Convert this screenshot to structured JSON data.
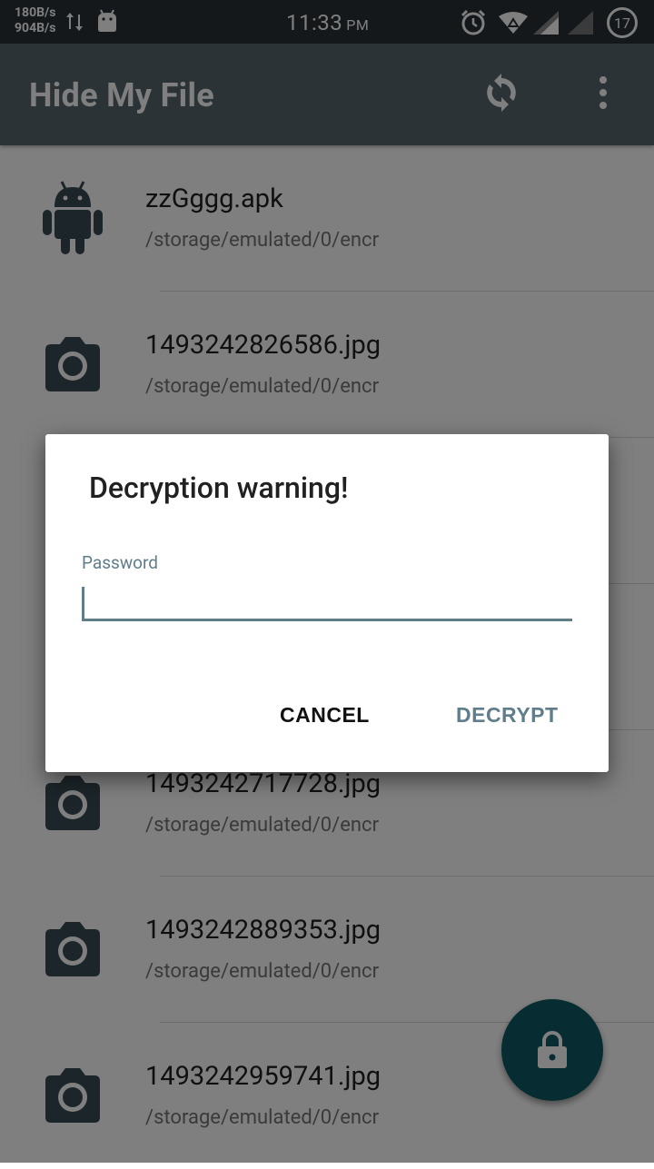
{
  "status_bar": {
    "speed_up": "180B/s",
    "speed_down": "904B/s",
    "time": "11:33",
    "ampm": "PM",
    "battery": "17"
  },
  "app_bar": {
    "title": "Hide My File",
    "icons": [
      "sync-icon",
      "more-vert-icon"
    ]
  },
  "files": [
    {
      "name": "zzGggg.apk",
      "path": "/storage/emulated/0/encr",
      "icon": "android-icon"
    },
    {
      "name": "1493242826586.jpg",
      "path": "/storage/emulated/0/encr",
      "icon": "camera-icon"
    },
    {
      "name": "",
      "path": "",
      "icon": "camera-icon"
    },
    {
      "name": "",
      "path": "",
      "icon": "camera-icon"
    },
    {
      "name": "1493242717728.jpg",
      "path": "/storage/emulated/0/encr",
      "icon": "camera-icon"
    },
    {
      "name": "1493242889353.jpg",
      "path": "/storage/emulated/0/encr",
      "icon": "camera-icon"
    },
    {
      "name": "1493242959741.jpg",
      "path": "/storage/emulated/0/encr",
      "icon": "camera-icon"
    }
  ],
  "dialog": {
    "title": "Decryption warning!",
    "password_label": "Password",
    "password_value": "",
    "cancel_label": "CANCEL",
    "decrypt_label": "DECRYPT"
  },
  "colors": {
    "app_bar": "#56666f",
    "accent": "#607d8b",
    "fab": "#0f5a66"
  }
}
